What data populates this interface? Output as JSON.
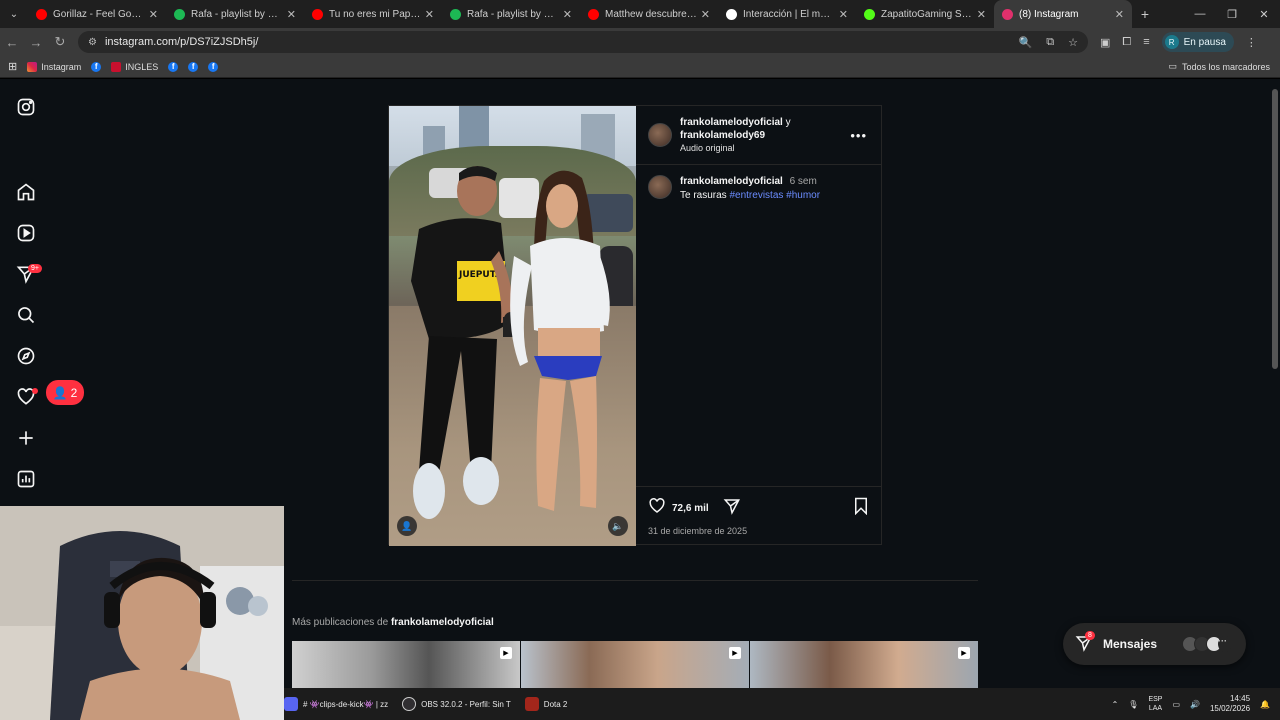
{
  "browser": {
    "tabs": [
      {
        "title": "Gorillaz - Feel Good Inc.",
        "color": "#ff0000"
      },
      {
        "title": "Rafa - playlist by RafaelJu",
        "color": "#1db954"
      },
      {
        "title": "Tu no eres mi Papá Cuyeyo",
        "color": "#ff0000"
      },
      {
        "title": "Rafa - playlist by RafaelJu",
        "color": "#1db954"
      },
      {
        "title": "Matthew descubre quién",
        "color": "#ff0000"
      },
      {
        "title": "Interacción | El mejor soft",
        "color": "#ffffff"
      },
      {
        "title": "ZapatitoGaming Stream",
        "color": "#53fc18"
      },
      {
        "title": "(8) Instagram",
        "color": "#e1306c"
      }
    ],
    "url": "instagram.com/p/DS7iZJSDh5j/",
    "profile_label": "En pausa",
    "profile_initial": "R",
    "bookmarks": [
      {
        "label": "Instagram"
      },
      {
        "label": "INGLES"
      }
    ],
    "bookmarks_all_label": "Todos los marcadores"
  },
  "sidebar": {
    "notification_count": "9+",
    "activity_count": "2"
  },
  "post": {
    "author1": "frankolamelodyoficial",
    "conjunction": "y",
    "author2": "frankolamelody69",
    "audio": "Audio original",
    "caption_user": "frankolamelodyoficial",
    "caption_age": "6 sem",
    "caption_text": "Te rasuras",
    "tag1": "#entrevistas",
    "tag2": "#humor",
    "likes": "72,6 mil",
    "date": "31 de diciembre de 2025",
    "shirt_text": "JUEPUTA"
  },
  "more_posts": {
    "prefix": "Más publicaciones de",
    "user": "frankolamelodyoficial"
  },
  "messages": {
    "label": "Mensajes",
    "badge": "8"
  },
  "taskbar": {
    "items": [
      {
        "label": "# 👾clips-de-kick👾 | zz"
      },
      {
        "label": "OBS 32.0.2 - Perfil: Sin T"
      },
      {
        "label": "Dota 2"
      }
    ],
    "lang_top": "ESP",
    "lang_bottom": "LAA",
    "time": "14:45",
    "date": "15/02/2026"
  }
}
